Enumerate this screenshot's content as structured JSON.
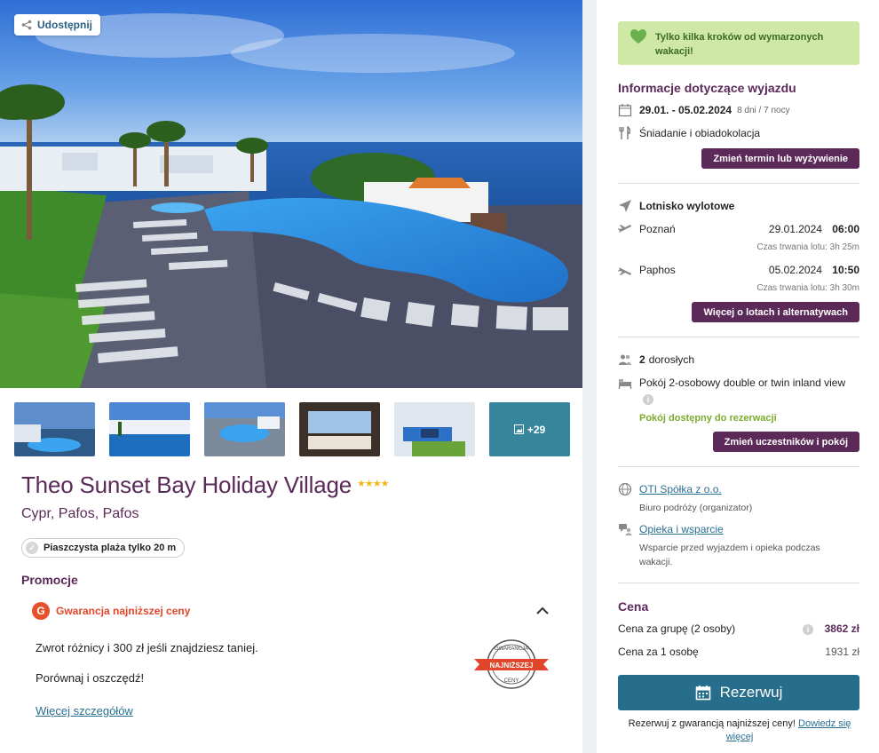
{
  "share": {
    "label": "Udostępnij",
    "icon": "share-icon"
  },
  "gallery": {
    "more_label": "+29"
  },
  "hotel": {
    "name": "Theo Sunset Bay Holiday Village",
    "stars": "★★★★",
    "location": "Cypr, Pafos, Pafos",
    "beach_badge": "Piaszczysta plaża tylko 20 m"
  },
  "promotions": {
    "heading": "Promocje",
    "guarantee_title": "Gwarancja najniższej ceny",
    "text1": "Zwrot różnicy i 300 zł jeśli znajdziesz taniej.",
    "text2": "Porównaj i oszczędź!",
    "more_link": "Więcej szczegółów",
    "seal": {
      "top": "GWARANCJA",
      "middle": "NAJNIŻSZEJ",
      "bottom": "CENY"
    }
  },
  "sidebar": {
    "notice": "Tylko kilka kroków od wymarzonych wakacji!",
    "trip": {
      "heading": "Informacje dotyczące wyjazdu",
      "dates": "29.01. - 05.02.2024",
      "duration": "8 dni / 7 nocy",
      "board": "Śniadanie i obiadokolacja",
      "change_button": "Zmień termin lub wyżywienie"
    },
    "flights": {
      "airport_label": "Lotnisko wylotowe",
      "outbound": {
        "city": "Poznań",
        "date": "29.01.2024",
        "time": "06:00",
        "duration": "Czas trwania lotu: 3h 25m"
      },
      "inbound": {
        "city": "Paphos",
        "date": "05.02.2024",
        "time": "10:50",
        "duration": "Czas trwania lotu: 3h 30m"
      },
      "more_button": "Więcej o lotach i alternatywach"
    },
    "participants": {
      "adults_count": "2",
      "adults_label": "dorosłych",
      "room": "Pokój 2-osobowy double or twin inland view",
      "availability": "Pokój dostępny do rezerwacji",
      "change_button": "Zmień uczestników i pokój"
    },
    "organizer": {
      "name": "OTI Spółka z o.o.",
      "role": "Biuro podróży (organizator)",
      "support_link": "Opieka i wsparcie",
      "support_desc": "Wsparcie przed wyjazdem i opieka podczas wakacji."
    },
    "price": {
      "heading": "Cena",
      "group_label": "Cena za grupę (2 osoby)",
      "group_value": "3862 zł",
      "person_label": "Cena za 1 osobę",
      "person_value": "1931 zł"
    },
    "reserve": {
      "button": "Rezerwuj",
      "note": "Rezerwuj z gwarancją najniższej ceny!",
      "note_link": "Dowiedz się więcej"
    }
  },
  "colors": {
    "brand_purple": "#5b2a59",
    "reserve_blue": "#276d8c",
    "notice_green": "#cfe8a5",
    "promo_orange": "#e0462a"
  }
}
